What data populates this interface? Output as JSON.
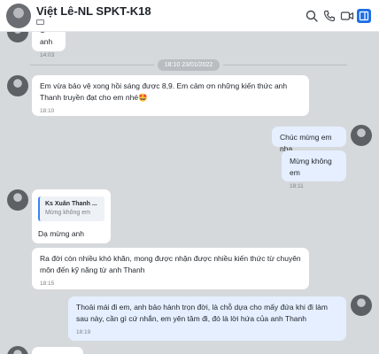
{
  "header": {
    "title": "Việt Lê-NL SPKT-K18"
  },
  "date_separator": "18:10 23/01/2022",
  "messages": {
    "m0": {
      "text": "Ừ anh",
      "time": "14:03"
    },
    "m1": {
      "text": "Em vừa bảo vệ xong hồi sáng được 8,9. Em cảm ơn những kiến thức anh Thanh truyền đạt cho em nhé🤩",
      "time": "18:10"
    },
    "m2": {
      "text": "Chúc mừng em nha"
    },
    "m3": {
      "text": "Mừng không em",
      "time": "18:11"
    },
    "m4": {
      "quote_name": "Ks Xuân Thanh ...",
      "quote_text": "Mừng không em",
      "text": "Dạ mừng anh"
    },
    "m5": {
      "text": "Ra đời còn nhiều khó khăn, mong được nhận được nhiều kiến thức từ chuyên môn đến kỹ năng từ anh Thanh",
      "time": "18:15"
    },
    "m6": {
      "text": "Thoải mái đi em, anh bảo hành trọn đời, là chỗ dựa cho mấy đứa khi đi làm sau này, cần gì cứ nhắn, em yên tâm đi, đó là lời hứa của anh Thanh",
      "time": "18:19"
    }
  }
}
